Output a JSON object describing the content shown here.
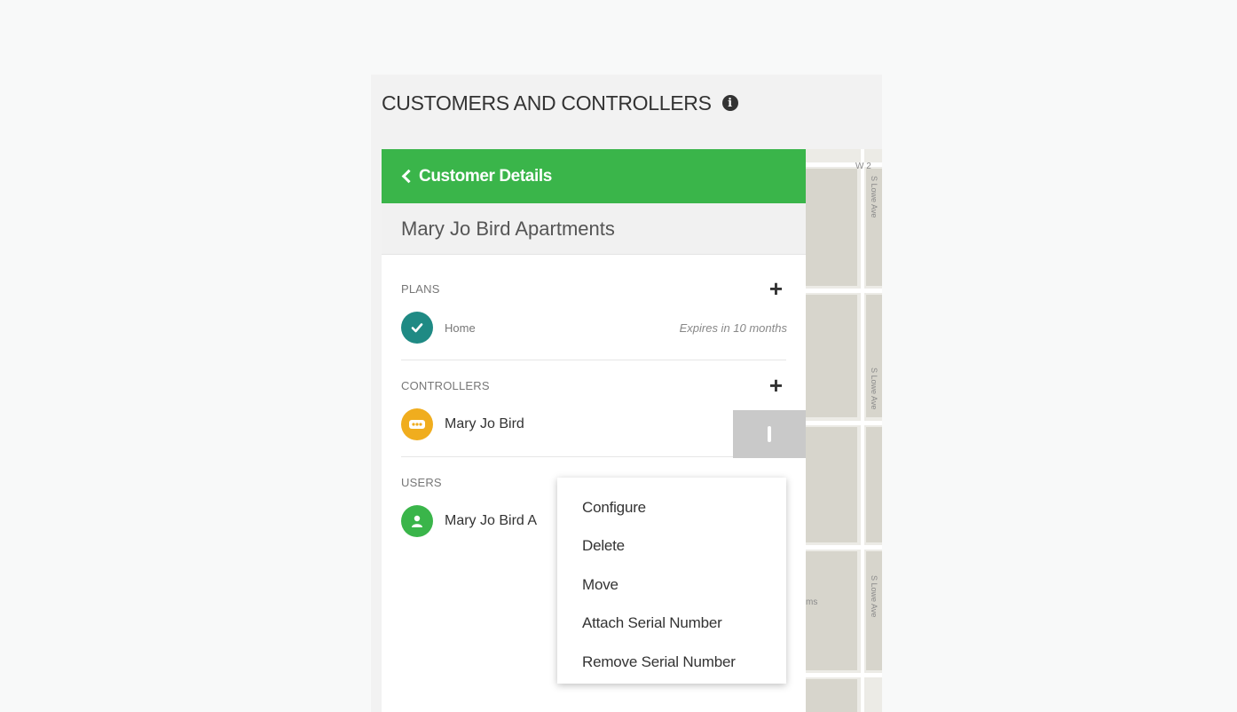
{
  "page": {
    "title": "CUSTOMERS AND CONTROLLERS",
    "info_icon": "info-icon"
  },
  "panel": {
    "back_label": "Customer Details",
    "customer_name": "Mary Jo Bird Apartments"
  },
  "plans": {
    "title": "PLANS",
    "add_icon": "plus-icon",
    "items": [
      {
        "name": "Home",
        "meta": "Expires in 10 months",
        "icon": "check-icon",
        "color": "#1f8a84"
      }
    ]
  },
  "controllers": {
    "title": "CONTROLLERS",
    "add_icon": "plus-icon",
    "items": [
      {
        "name": "Mary Jo Bird",
        "icon": "controller-icon",
        "color": "#f0ad1e"
      }
    ]
  },
  "users": {
    "title": "USERS",
    "items": [
      {
        "name": "Mary Jo Bird A",
        "icon": "user-icon",
        "color": "#3ab54a"
      }
    ]
  },
  "context_menu": {
    "items": [
      {
        "label": "Configure"
      },
      {
        "label": "Delete"
      },
      {
        "label": "Move"
      },
      {
        "label": "Attach Serial Number"
      },
      {
        "label": "Remove Serial Number"
      }
    ]
  },
  "map": {
    "labels": [
      "W 2",
      "S Lowe Ave",
      "S Lowe Ave",
      "S Lowe Ave",
      "ms"
    ]
  },
  "colors": {
    "accent": "#3ab54a",
    "kebab_bg": "#c9c9c9"
  }
}
